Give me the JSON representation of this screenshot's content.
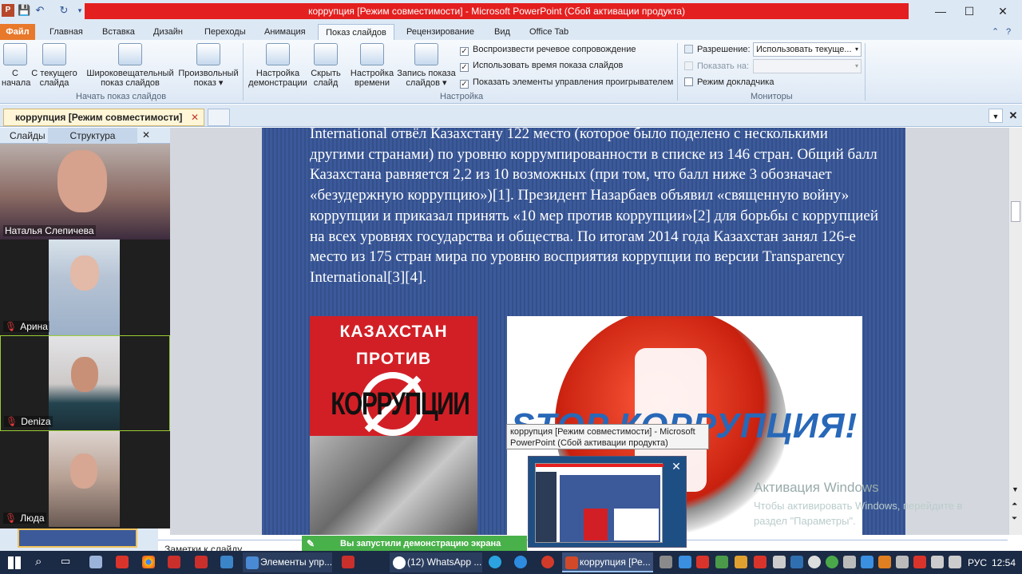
{
  "window": {
    "title": "коррупция [Режим совместимости]  -  Microsoft PowerPoint (Сбой активации продукта)",
    "minimize": "—",
    "maximize": "☐",
    "close": "✕"
  },
  "ribbon_tabs": [
    "Файл",
    "Главная",
    "Вставка",
    "Дизайн",
    "Переходы",
    "Анимация",
    "Показ слайдов",
    "Рецензирование",
    "Вид",
    "Office Tab"
  ],
  "ribbon": {
    "start_group": {
      "label": "Начать показ слайдов",
      "from_start": "С начала",
      "from_current": "С текущего слайда",
      "broadcast": "Широковещательный показ слайдов",
      "custom": "Произвольный показ ▾"
    },
    "setup_group": {
      "label": "Настройка",
      "setup_show": "Настройка демонстрации",
      "hide_slide": "Скрыть слайд",
      "rehearse": "Настройка времени",
      "record": "Запись показа слайдов ▾",
      "play_narration": "Воспроизвести речевое сопровождение",
      "use_timings": "Использовать время показа слайдов",
      "show_controls": "Показать элементы управления проигрывателем"
    },
    "monitors_group": {
      "label": "Мониторы",
      "resolution_label": "Разрешение:",
      "resolution_value": "Использовать текуще...",
      "show_on_label": "Показать на:",
      "show_on_value": "",
      "presenter_view": "Режим докладчика"
    }
  },
  "doc_tab": {
    "title": "коррупция [Режим совместимости]",
    "close": "✕"
  },
  "left_pane": {
    "tab_slides": "Слайды",
    "tab_outline": "Структура",
    "close": "✕"
  },
  "participants": [
    {
      "name": "Наталья Слепичева",
      "muted": false
    },
    {
      "name": "Арина",
      "muted": true
    },
    {
      "name": "Deniza",
      "muted": true
    },
    {
      "name": "Люда",
      "muted": true
    }
  ],
  "slide": {
    "text": "International отвёл Казахстану 122 место (которое было поделено с несколькими другими странами) по уровню коррумпированности в списке из 146 стран. Общий балл Казахстана равняется 2,2 из 10 возможных (при том, что балл ниже 3 обозначает «безудержную коррупцию»)[1]. Президент Назарбаев объявил «священную войну» коррупции и приказал принять «10 мер против коррупции»[2] для борьбы с коррупцией на всех уровнях государства и общества. По итогам 2014 года Казахстан занял 126-е место из 175 стран мира по уровню восприятия коррупции по версии Transparency International[3][4].",
    "poster_line1": "КАЗАХСТАН",
    "poster_line2": "ПРОТИВ",
    "poster_line3": "КОРРУПЦИИ",
    "stop_text": "STOP КОРРУПЦИЯ!"
  },
  "notes_placeholder": "Заметки к слайду",
  "share_banner": "Вы запустили демонстрацию экрана",
  "tooltip": "коррупция [Режим совместимости] - Microsoft PowerPoint (Сбой активации продукта)",
  "watermark": {
    "title": "Активация Windows",
    "body": "Чтобы активировать Windows, перейдите в раздел \"Параметры\"."
  },
  "taskbar": {
    "app1": "Элементы упр...",
    "app2": "(12) WhatsApp ...",
    "app3": "коррупция [Ре...",
    "lang": "РУС",
    "time": "12:54"
  },
  "colors": {
    "title_red": "#e41f1f",
    "file_tab": "#e8782a",
    "slide_blue": "#3c5a9a",
    "share_green": "#49b14a",
    "taskbar": "#1b2a45"
  }
}
